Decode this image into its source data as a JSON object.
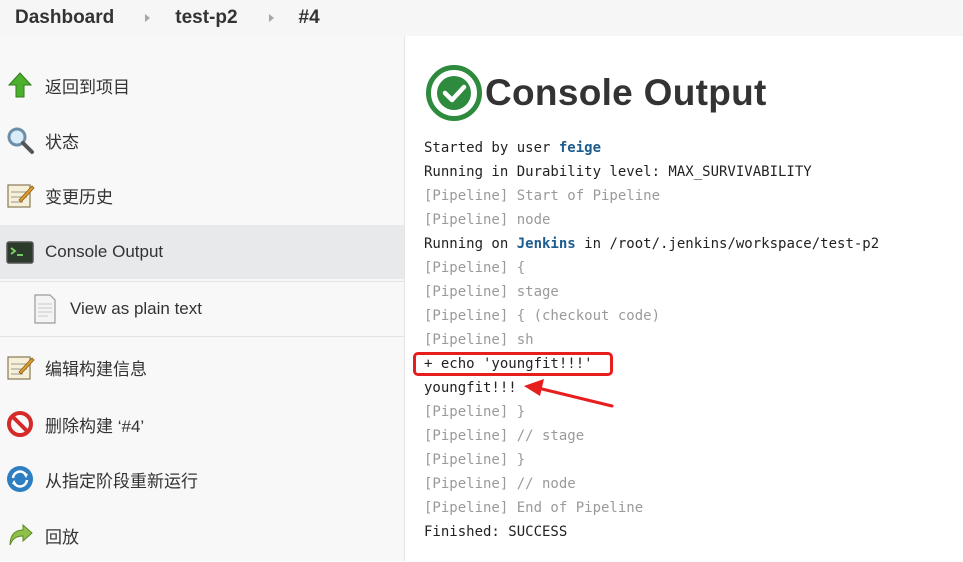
{
  "breadcrumb": {
    "items": [
      "Dashboard",
      "test-p2",
      "#4"
    ]
  },
  "sidebar": {
    "items": [
      {
        "label": "返回到项目",
        "icon": "up-arrow-icon"
      },
      {
        "label": "状态",
        "icon": "search-icon"
      },
      {
        "label": "变更历史",
        "icon": "notepad-icon"
      },
      {
        "label": "Console Output",
        "icon": "terminal-icon",
        "active": true
      },
      {
        "label": "View as plain text",
        "icon": "document-icon"
      },
      {
        "label": "编辑构建信息",
        "icon": "notepad-icon"
      },
      {
        "label": "删除构建 ‘#4’",
        "icon": "no-entry-icon"
      },
      {
        "label": "从指定阶段重新运行",
        "icon": "refresh-icon"
      },
      {
        "label": "回放",
        "icon": "replay-arrow-icon"
      }
    ]
  },
  "main": {
    "title": "Console Output",
    "status_icon": "success-check-icon",
    "console": {
      "started_prefix": "Started by user ",
      "started_user": "feige",
      "durability": "Running in Durability level: MAX_SURVIVABILITY",
      "pipe1": "[Pipeline] Start of Pipeline",
      "pipe2": "[Pipeline] node",
      "running_prefix": "Running on ",
      "running_node": "Jenkins",
      "running_suffix": " in /root/.jenkins/workspace/test-p2",
      "pipe3": "[Pipeline] {",
      "pipe4": "[Pipeline] stage",
      "pipe5": "[Pipeline] { (checkout code)",
      "pipe6": "[Pipeline] sh",
      "echo_cmd": "+ echo 'youngfit!!!'",
      "echo_out": "youngfit!!!",
      "pipe7": "[Pipeline] }",
      "pipe8": "[Pipeline] // stage",
      "pipe9": "[Pipeline] }",
      "pipe10": "[Pipeline] // node",
      "pipe11": "[Pipeline] End of Pipeline",
      "finished": "Finished: SUCCESS"
    }
  },
  "colors": {
    "success_green": "#2e8b3d",
    "link_blue": "#1d5d90",
    "annotation_red": "#e61e1e"
  }
}
